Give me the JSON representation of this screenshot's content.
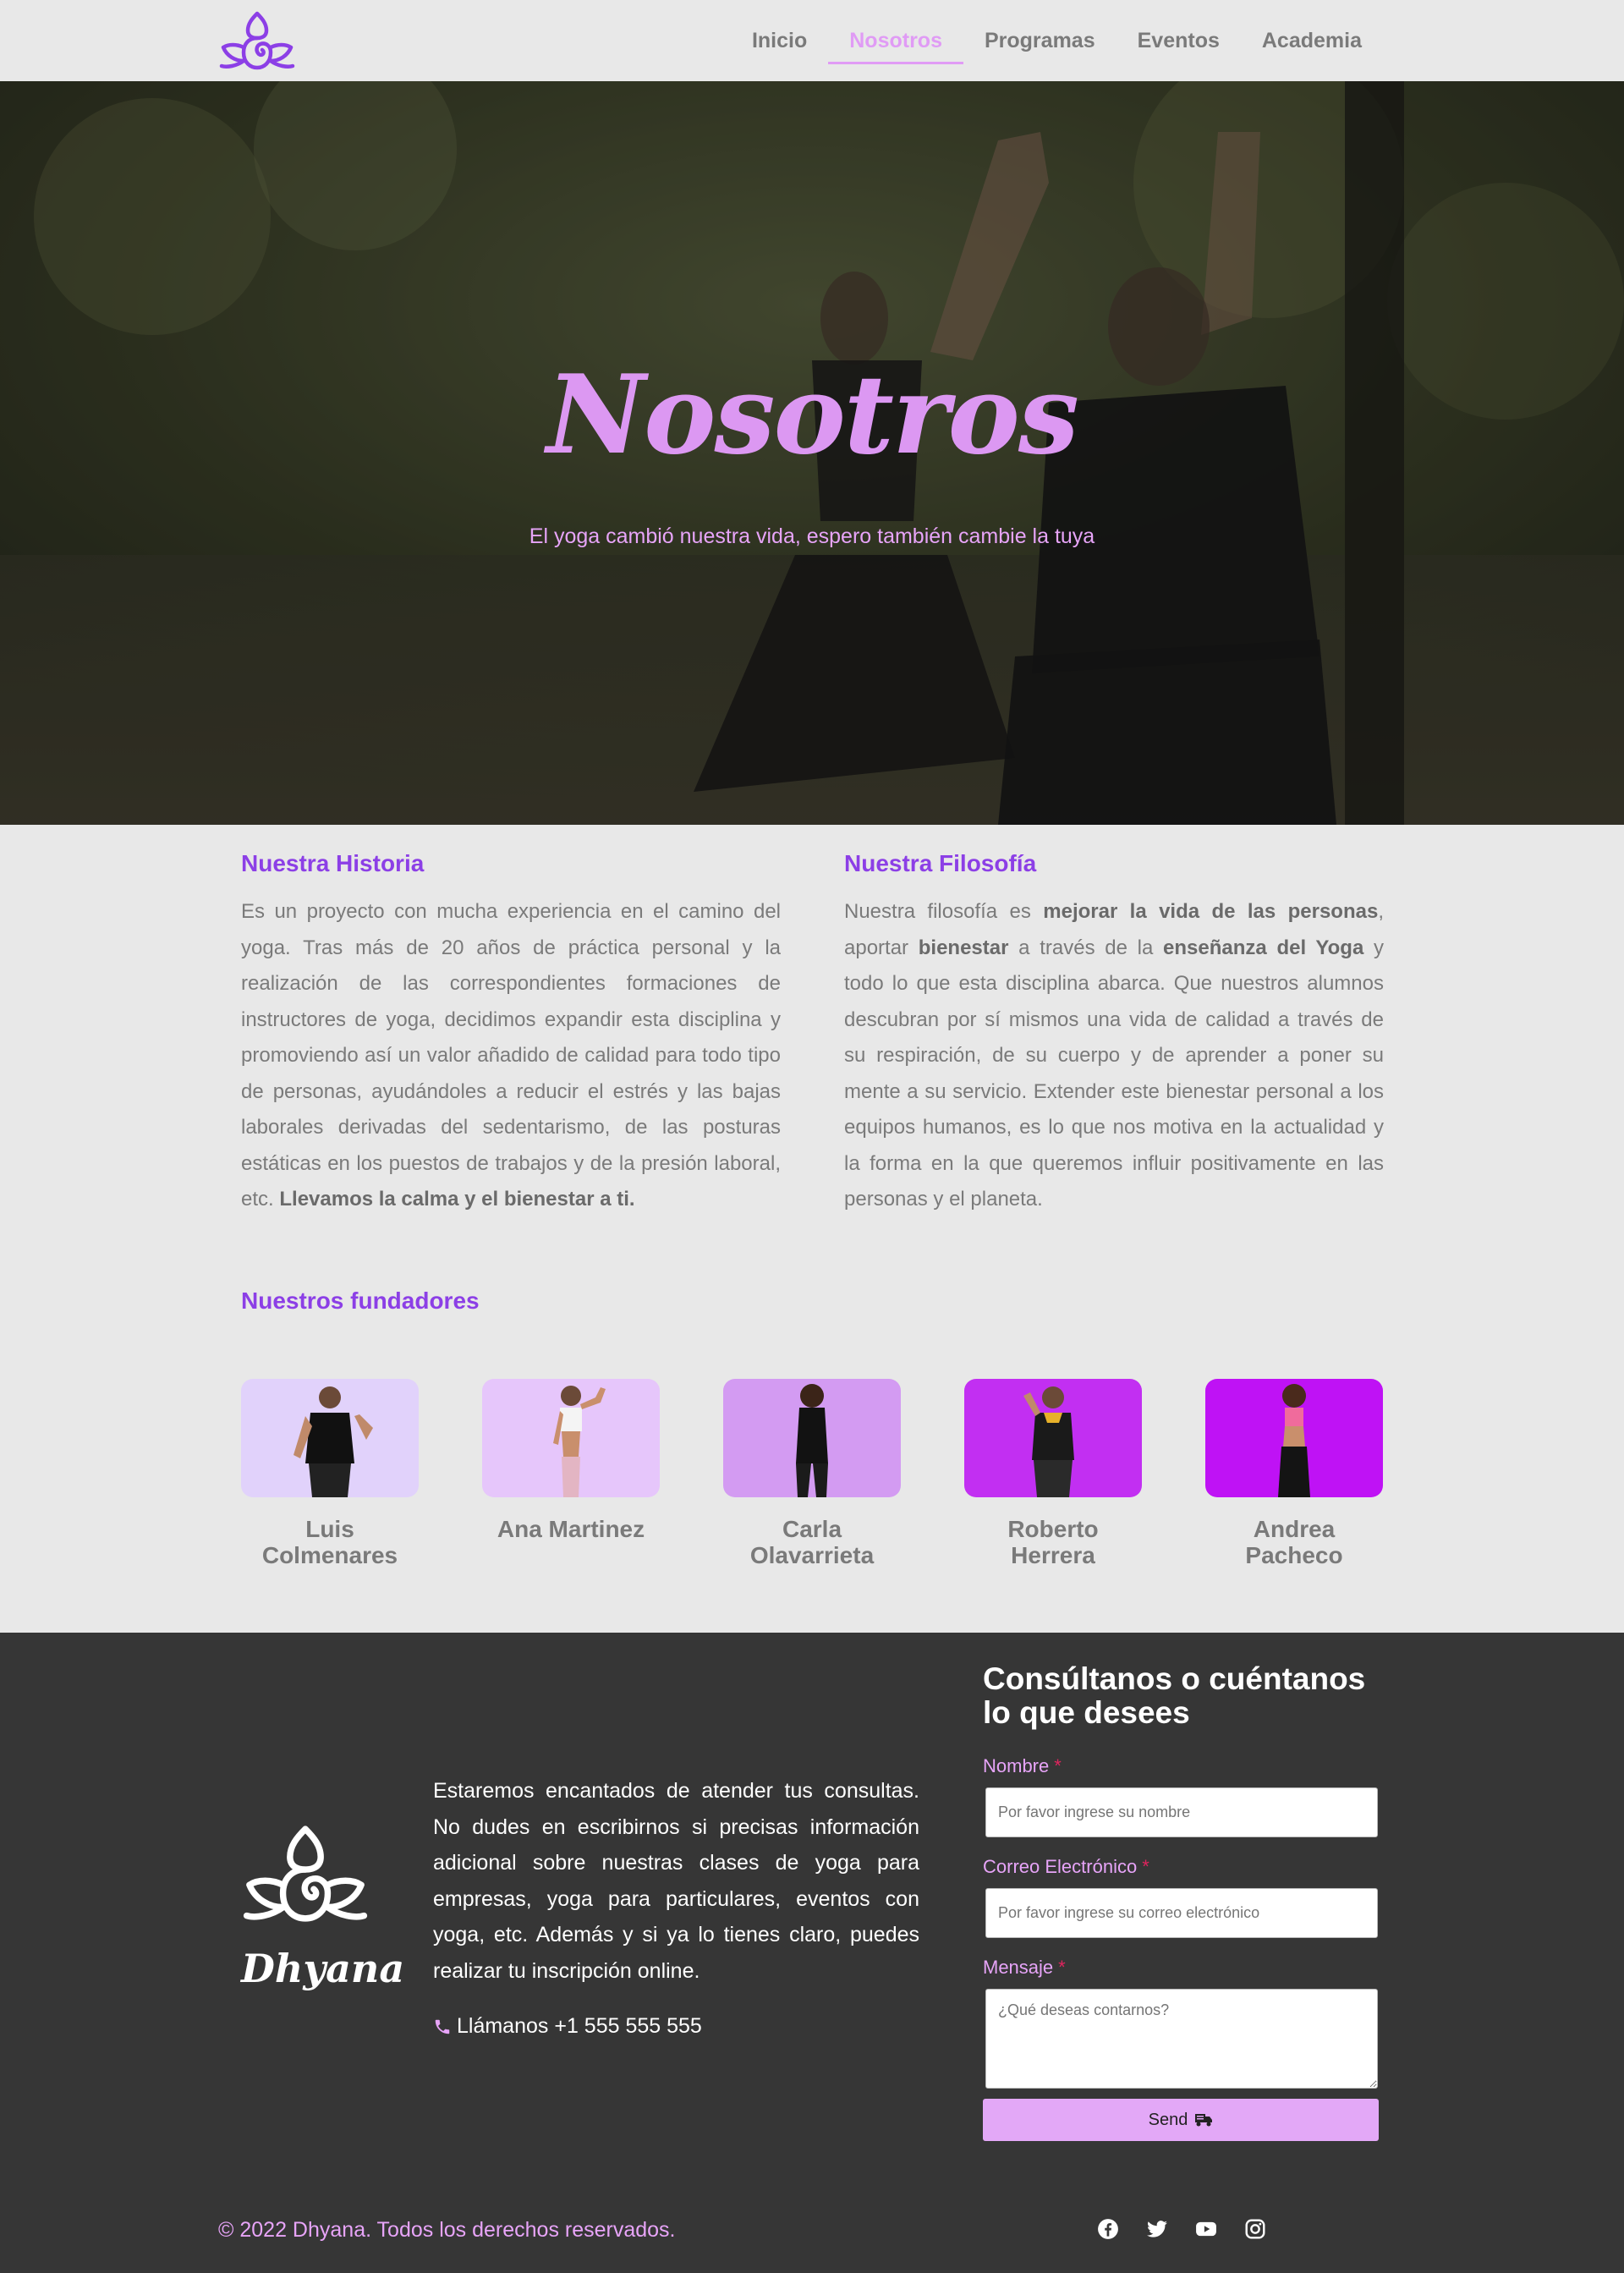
{
  "nav": {
    "logo": "lotus-logo-icon",
    "items": [
      {
        "label": "Inicio",
        "active": false
      },
      {
        "label": "Nosotros",
        "active": true
      },
      {
        "label": "Programas",
        "active": false
      },
      {
        "label": "Eventos",
        "active": false
      },
      {
        "label": "Academia",
        "active": false
      }
    ]
  },
  "hero": {
    "title": "Nosotros",
    "subtitle": "El yoga cambió nuestra vida, espero también cambie la tuya"
  },
  "historia": {
    "title": "Nuestra Historia",
    "text": "Es un proyecto con mucha experiencia en el camino del yoga. Tras más de 20 años de práctica personal y la realización de las correspondientes formaciones de instructores de yoga, decidimos expandir esta disciplina y promoviendo así un valor añadido de calidad para todo tipo de personas, ayudándoles a reducir el estrés y las bajas laborales derivadas del sedentarismo, de las posturas estáticas en los puestos de trabajos y de la presión laboral, etc. ",
    "bold": "Llevamos la calma y el bienestar a ti."
  },
  "filosofia": {
    "title": "Nuestra Filosofía",
    "p1": "Nuestra filosofía es ",
    "b1": "mejorar la vida de las personas",
    "p2": ", aportar ",
    "b2": "bienestar",
    "p3": " a través de la ",
    "b3": "enseñanza del Yoga",
    "p4": " y todo lo que esta disciplina abarca. Que nuestros alumnos descubran por sí mismos una vida de calidad a través de su respiración, de su cuerpo y de aprender a poner su mente a su servicio. Extender este bienestar personal a los equipos humanos, es lo que nos motiva en la actualidad y la forma en la que queremos influir positivamente en las personas y el planeta."
  },
  "founders": {
    "title": "Nuestros fundadores",
    "people": [
      {
        "name": "Luis Colmenares",
        "bg": "#e1d2fb"
      },
      {
        "name": "Ana Martinez",
        "bg": "#e6c6fb"
      },
      {
        "name": "Carla Olavarrieta",
        "bg": "#d39bf2"
      },
      {
        "name": "Roberto Herrera",
        "bg": "#c22ff2"
      },
      {
        "name": "Andrea Pacheco",
        "bg": "#bf12f5"
      }
    ]
  },
  "footer": {
    "brand": "Dhyana",
    "text": "Estaremos encantados de atender tus consultas. No dudes en escribirnos si precisas información adicional sobre nuestras clases de yoga para empresas, yoga para particulares, eventos con yoga, etc. Además y si ya lo tienes claro, puedes realizar tu inscripción online.",
    "phone": "Llámanos +1 555 555 555",
    "copyright": "© 2022 Dhyana. Todos los derechos reservados.",
    "social": [
      "facebook-icon",
      "twitter-icon",
      "youtube-icon",
      "instagram-icon"
    ]
  },
  "form": {
    "title": "Consúltanos o cuéntanos lo que desees",
    "name_label": "Nombre",
    "name_placeholder": "Por favor ingrese su nombre",
    "email_label": "Correo Electrónico",
    "email_placeholder": "Por favor ingrese su correo electrónico",
    "message_label": "Mensaje",
    "message_placeholder": "¿Qué deseas contarnos?",
    "required": "*",
    "send": "Send"
  },
  "colors": {
    "accent": "#8c3fe6",
    "pink": "#e7a4f8",
    "footer_bg": "#363636",
    "page_bg": "#e8e8e8"
  }
}
